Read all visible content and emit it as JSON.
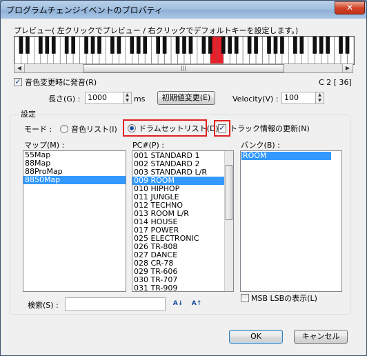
{
  "window": {
    "title": "プログラムチェンジイベントのプロパティ",
    "close_glyph": "✕"
  },
  "preview": {
    "label": "プレビュー( 左クリックでプレビュー / 右クリックでデフォルトキーを設定します。)"
  },
  "sound_on_change": {
    "label": "音色変更時に発音(R)",
    "checked": true,
    "note_readout": "C  2 [ 36]"
  },
  "length": {
    "label": "長さ(G) :",
    "value": "1000",
    "unit": "ms"
  },
  "reset_button": {
    "label": "初期値変更(E)"
  },
  "velocity": {
    "label": "Velocity(V) :",
    "value": "100"
  },
  "settings": {
    "group_label": "設定",
    "mode_label": "モード :",
    "mode_tone_list": "音色リスト(I)",
    "mode_drum_list": "ドラムセットリスト(D)",
    "track_update": "トラック情報の更新(N)"
  },
  "map": {
    "label": "マップ(M) :",
    "items": [
      "55Map",
      "88Map",
      "88ProMap",
      "8850Map"
    ],
    "selected_index": 3
  },
  "pc": {
    "label": "PC#(P) :",
    "items": [
      "001 STANDARD 1",
      "002 STANDARD 2",
      "003 STANDARD L/R",
      "009 ROOM",
      "010 HIPHOP",
      "011 JUNGLE",
      "012 TECHNO",
      "013 ROOM L/R",
      "014 HOUSE",
      "017 POWER",
      "025 ELECTRONIC",
      "026 TR-808",
      "027 DANCE",
      "028 CR-78",
      "029 TR-606",
      "030 TR-707",
      "031 TR-909"
    ],
    "selected_index": 3
  },
  "bank": {
    "label": "バンク(B) :",
    "items": [
      "ROOM"
    ],
    "selected_index": 0
  },
  "msb_lsb": {
    "label": "MSB LSBの表示(L)",
    "checked": false
  },
  "search": {
    "label": "検索(S) :",
    "value": ""
  },
  "footer": {
    "ok": "OK",
    "cancel": "キャンセル"
  },
  "keyboard": {
    "highlight_color": "#e8202a"
  }
}
